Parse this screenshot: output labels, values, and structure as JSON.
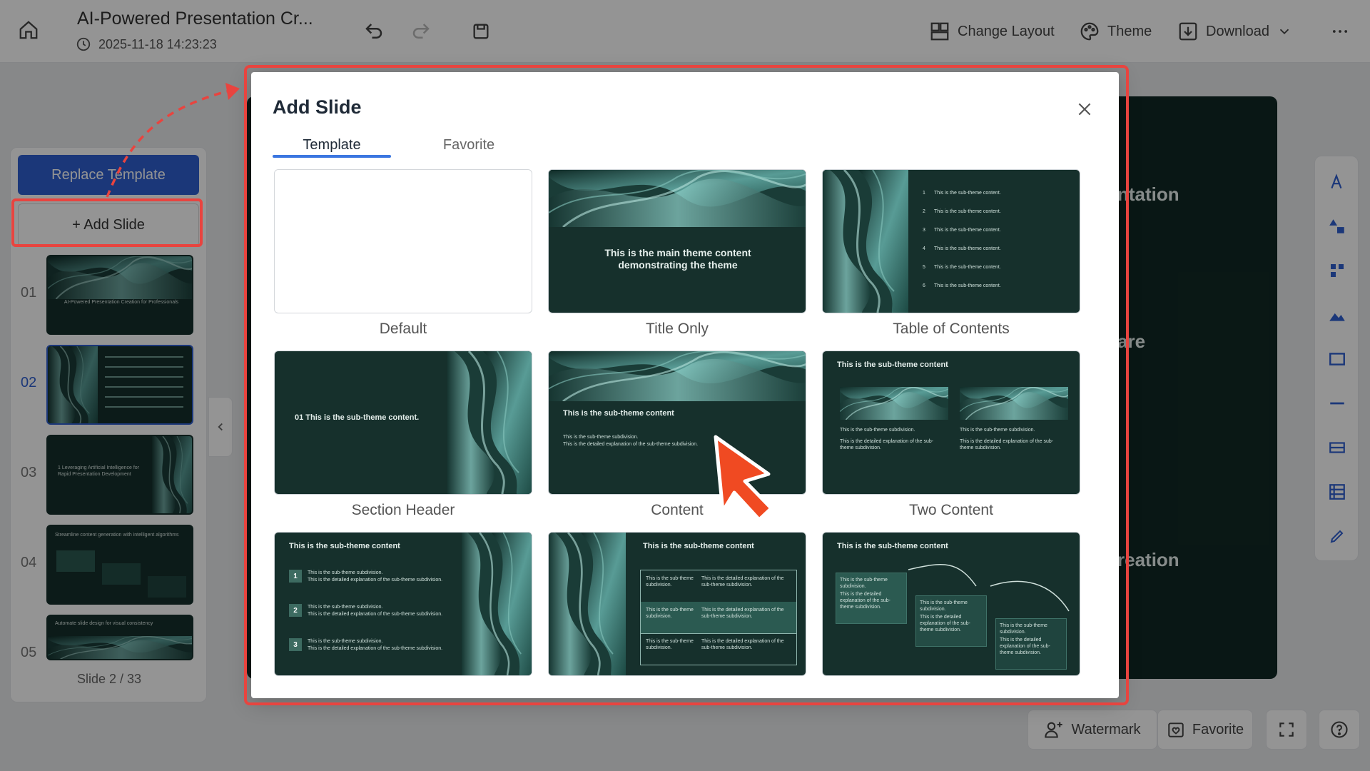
{
  "app": {
    "document_title": "AI-Powered Presentation Cr...",
    "saved_time": "2025-11-18 14:23:23"
  },
  "toolbar": {
    "change_layout_label": "Change Layout",
    "theme_label": "Theme",
    "download_label": "Download"
  },
  "left_panel": {
    "replace_template_label": "Replace Template",
    "add_slide_label": "+ Add Slide",
    "thumbnails": [
      {
        "num": "01",
        "text": "AI-Powered Presentation Creation for Professionals"
      },
      {
        "num": "02",
        "text": ""
      },
      {
        "num": "03",
        "text": "1 Leveraging Artificial Intelligence for Rapid Presentation Development"
      },
      {
        "num": "04",
        "text": "Streamline content generation with intelligent algorithms"
      },
      {
        "num": "05",
        "text": "Automate slide design for visual consistency"
      }
    ],
    "slide_counter": "Slide 2 / 33"
  },
  "canvas": {
    "fragment_1": "ntation",
    "fragment_2": "are",
    "fragment_3": "reation"
  },
  "bottom_bar": {
    "watermark_label": "Watermark",
    "favorite_label": "Favorite"
  },
  "modal": {
    "title": "Add Slide",
    "tabs": [
      {
        "label": "Template",
        "active": true
      },
      {
        "label": "Favorite",
        "active": false
      }
    ],
    "templates": [
      {
        "label": "Default"
      },
      {
        "label": "Title Only",
        "preview_text": "This is the main theme content demonstrating the theme"
      },
      {
        "label": "Table of Contents",
        "preview_item": "This is the sub-theme content.",
        "preview_numbers": [
          "1",
          "2",
          "3",
          "4",
          "5",
          "6"
        ]
      },
      {
        "label": "Section Header",
        "preview_text": "01 This is the sub-theme content."
      },
      {
        "label": "Content",
        "preview_heading": "This is the sub-theme content",
        "preview_line1": "This is the sub-theme subdivision.",
        "preview_line2": "This is the detailed explanation of the sub-theme subdivision."
      },
      {
        "label": "Two Content",
        "preview_heading": "This is the sub-theme content",
        "preview_line1": "This is the sub-theme subdivision.",
        "preview_line2": "This is the detailed explanation of the sub-theme subdivision."
      },
      {
        "preview_heading": "This is the sub-theme content",
        "preview_numbers": [
          "1",
          "2",
          "3"
        ],
        "preview_line1": "This is the sub-theme subdivision.",
        "preview_line2": "This is the detailed explanation of the sub-theme subdivision."
      },
      {
        "preview_heading": "This is the sub-theme content",
        "preview_line1": "This is the sub-theme subdivision.",
        "preview_line2": "This is the detailed explanation of the sub-theme subdivision."
      },
      {
        "preview_heading": "This is the sub-theme content",
        "preview_line1": "This is the sub-theme subdivision.",
        "preview_line2": "This is the detailed explanation of the sub-theme subdivision."
      }
    ]
  },
  "colors": {
    "accent": "#3b76e0",
    "highlight": "#e8443f",
    "slide_bg": "#16302c",
    "primary_button": "#2f5fd0"
  },
  "icons": {
    "home": "home-icon",
    "history": "history-icon",
    "undo": "undo-icon",
    "redo": "redo-icon",
    "save": "save-icon",
    "close": "close-icon",
    "cursor": "mouse-cursor-icon"
  }
}
